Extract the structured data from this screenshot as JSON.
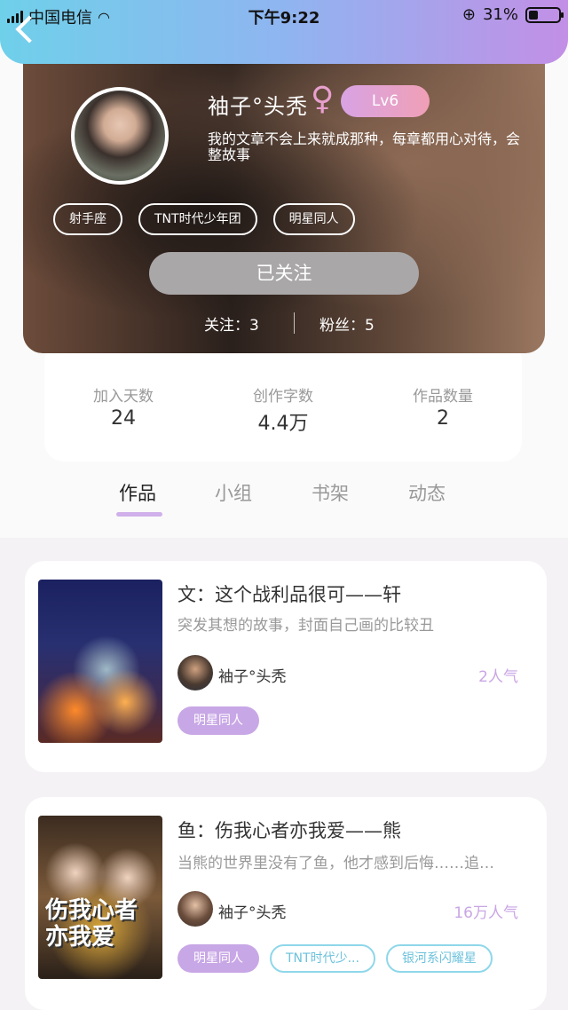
{
  "status": {
    "carrier": "中国电信",
    "time": "下午9:22",
    "battery": "31%",
    "battery_level": 0.31
  },
  "nav": {
    "back_icon": "chevron-left-icon"
  },
  "profile": {
    "username": "袖子°头秃",
    "gender_icon": "♀",
    "level": "Lv6",
    "bio_line1": "我的文章不会上来就成那种，每章都用心对待，会",
    "bio_line2": "整故事",
    "tags": [
      "射手座",
      "TNT时代少年团",
      "明星同人"
    ],
    "follow_button": "已关注",
    "following": "关注：3",
    "followers": "粉丝：5"
  },
  "stats": [
    {
      "label": "加入天数",
      "value": "24"
    },
    {
      "label": "创作字数",
      "value": "4.4万"
    },
    {
      "label": "作品数量",
      "value": "2"
    }
  ],
  "tabs": [
    "作品",
    "小组",
    "书架",
    "动态"
  ],
  "works": [
    {
      "title": "文：这个战利品很可——轩",
      "desc": "突发其想的故事，封面自己画的比较丑",
      "author": "袖子°头秃",
      "popularity": "2人气",
      "tags": [
        "明星同人"
      ]
    },
    {
      "title": "鱼：伤我心者亦我爱——熊",
      "desc": "当熊的世界里没有了鱼，他才感到后悔……追…",
      "author": "袖子°头秃",
      "popularity": "16万人气",
      "cover_text": "伤我心者亦我爱",
      "tags": [
        "明星同人",
        "TNT时代少...",
        "银河系闪耀星"
      ]
    }
  ]
}
